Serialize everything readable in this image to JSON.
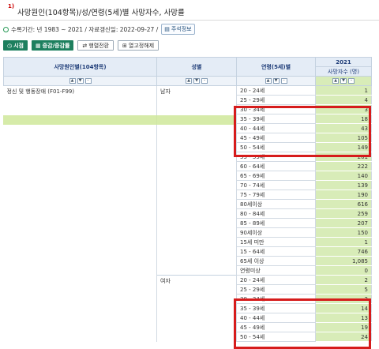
{
  "title": {
    "num": "1)",
    "text": "사망원인(104항목)/성/연령(5세)별 사망자수, 사망률"
  },
  "meta": {
    "text": "수록기간: 년 1983 ~ 2021 / 자료갱신일: 2022-09-27 /",
    "link_label": "주석정보"
  },
  "toolbar": {
    "btn1": "시점",
    "btn2": "증감/증감률",
    "btn3": "행렬전환",
    "btn4": "열고정해제"
  },
  "table": {
    "headers": {
      "cause": "사망원인별(104항목)",
      "sex": "성별",
      "age": "연령(5세)별",
      "year": "2021",
      "unit": "사망자수 (명)"
    },
    "cause": "정신 및 행동장애 (F01-F99)",
    "sex_m": "남자",
    "sex_f": "여자",
    "rows": [
      {
        "age": "20 - 24세",
        "value": "1"
      },
      {
        "age": "25 - 29세",
        "value": "4"
      },
      {
        "age": "30 - 34세",
        "value": "3"
      },
      {
        "age": "35 - 39세",
        "value": "18"
      },
      {
        "age": "40 - 44세",
        "value": "43"
      },
      {
        "age": "45 - 49세",
        "value": "105"
      },
      {
        "age": "50 - 54세",
        "value": "149"
      },
      {
        "age": "55 - 59세",
        "value": "201"
      },
      {
        "age": "60 - 64세",
        "value": "222"
      },
      {
        "age": "65 - 69세",
        "value": "140"
      },
      {
        "age": "70 - 74세",
        "value": "139"
      },
      {
        "age": "75 - 79세",
        "value": "190"
      },
      {
        "age": "80세이상",
        "value": "616"
      },
      {
        "age": "80 - 84세",
        "value": "259"
      },
      {
        "age": "85 - 89세",
        "value": "207"
      },
      {
        "age": "90세이상",
        "value": "150"
      },
      {
        "age": "15세 미만",
        "value": "1"
      },
      {
        "age": "15 - 64세",
        "value": "746"
      },
      {
        "age": "65세 이상",
        "value": "1,085"
      },
      {
        "age": "연령미상",
        "value": "0"
      },
      {
        "age": "20 - 24세",
        "value": "2"
      },
      {
        "age": "25 - 29세",
        "value": "5"
      },
      {
        "age": "30 - 34세",
        "value": "2"
      },
      {
        "age": "35 - 39세",
        "value": "14"
      },
      {
        "age": "40 - 44세",
        "value": "13"
      },
      {
        "age": "45 - 49세",
        "value": "19"
      },
      {
        "age": "50 - 54세",
        "value": "24"
      }
    ]
  },
  "colors": {
    "highlight_box": "#d61c1c",
    "value_cell": "#d8ecb8",
    "header_bg": "#e4ecf6",
    "selected_row": "#cfe89a",
    "button_green": "#1d7f5e"
  }
}
